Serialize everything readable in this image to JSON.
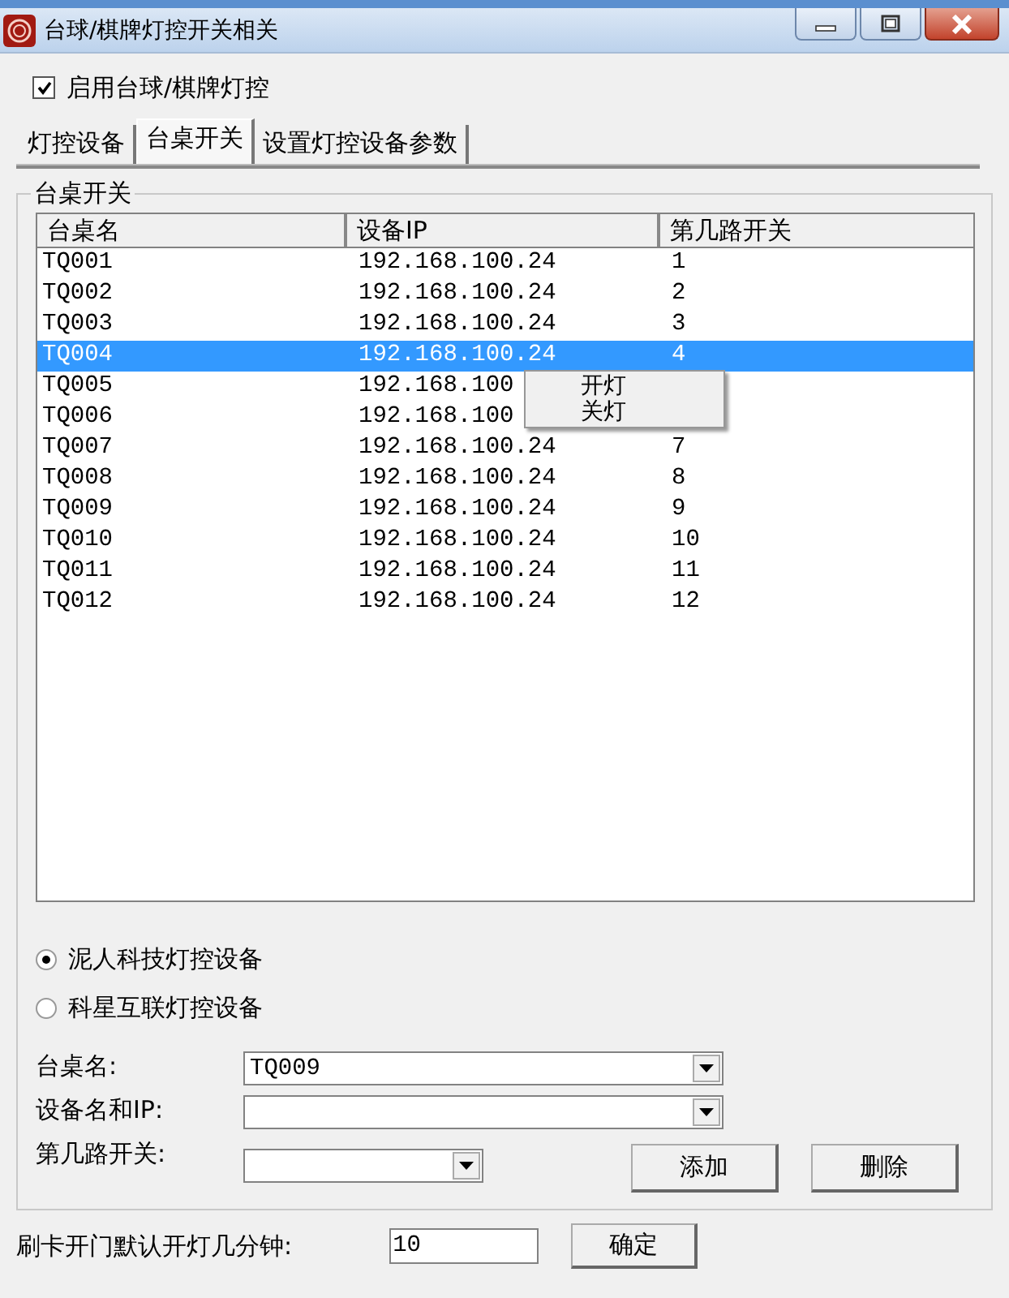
{
  "window": {
    "title": "台球/棋牌灯控开关相关"
  },
  "enable": {
    "label": "启用台球/棋牌灯控",
    "checked": true
  },
  "tabs": [
    {
      "label": "灯控设备",
      "selected": false
    },
    {
      "label": "台桌开关",
      "selected": true
    },
    {
      "label": "设置灯控设备参数",
      "selected": false
    }
  ],
  "group": {
    "title": "台桌开关"
  },
  "table": {
    "columns": [
      "台桌名",
      "设备IP",
      "第几路开关"
    ],
    "rows": [
      {
        "cells": [
          "TQ001",
          "192.168.100.24",
          "1"
        ],
        "selected": false
      },
      {
        "cells": [
          "TQ002",
          "192.168.100.24",
          "2"
        ],
        "selected": false
      },
      {
        "cells": [
          "TQ003",
          "192.168.100.24",
          "3"
        ],
        "selected": false
      },
      {
        "cells": [
          "TQ004",
          "192.168.100.24",
          "4"
        ],
        "selected": true
      },
      {
        "cells": [
          "TQ005",
          "192.168.100"
        ],
        "selected": false
      },
      {
        "cells": [
          "TQ006",
          "192.168.100"
        ],
        "selected": false
      },
      {
        "cells": [
          "TQ007",
          "192.168.100.24",
          "7"
        ],
        "selected": false
      },
      {
        "cells": [
          "TQ008",
          "192.168.100.24",
          "8"
        ],
        "selected": false
      },
      {
        "cells": [
          "TQ009",
          "192.168.100.24",
          "9"
        ],
        "selected": false
      },
      {
        "cells": [
          "TQ010",
          "192.168.100.24",
          "10"
        ],
        "selected": false
      },
      {
        "cells": [
          "TQ011",
          "192.168.100.24",
          "11"
        ],
        "selected": false
      },
      {
        "cells": [
          "TQ012",
          "192.168.100.24",
          "12"
        ],
        "selected": false
      }
    ]
  },
  "context_menu": {
    "items": [
      "开灯",
      "关灯"
    ]
  },
  "device_types": [
    {
      "label": "泥人科技灯控设备",
      "selected": true
    },
    {
      "label": "科星互联灯控设备",
      "selected": false
    }
  ],
  "form": [
    {
      "label": "台桌名:",
      "value": "TQ009"
    },
    {
      "label": "设备名和IP:"
    },
    {
      "label": "第几路开关:"
    }
  ],
  "buttons": [
    "添加",
    "删除"
  ],
  "minutes": {
    "label": "刷卡开门默认开灯几分钟:",
    "value": "10",
    "button": "确定"
  }
}
